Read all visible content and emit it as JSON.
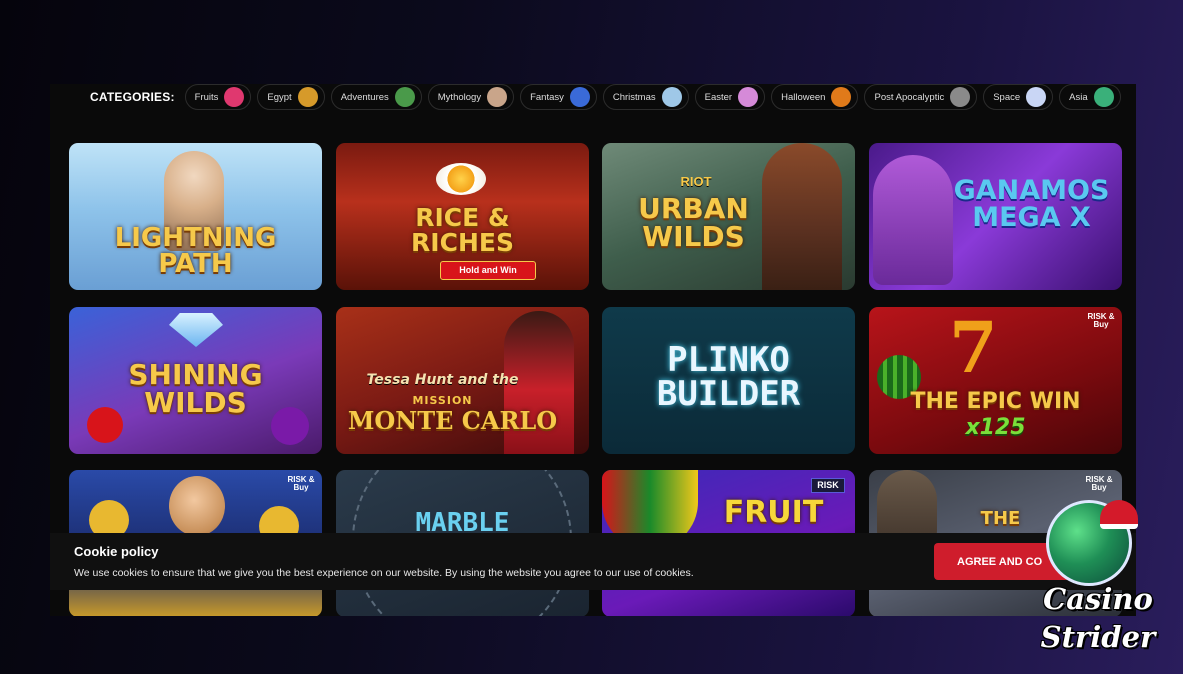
{
  "categories": {
    "label": "CATEGORIES:",
    "items": [
      {
        "label": "Fruits",
        "icon": "dragon-fruit-icon",
        "color": "#e0386f"
      },
      {
        "label": "Egypt",
        "icon": "pharaoh-icon",
        "color": "#d69a2a"
      },
      {
        "label": "Adventures",
        "icon": "explorer-icon",
        "color": "#4a9a4a"
      },
      {
        "label": "Mythology",
        "icon": "zeus-icon",
        "color": "#c9a58a"
      },
      {
        "label": "Fantasy",
        "icon": "blue-dragon-icon",
        "color": "#3a6ad8"
      },
      {
        "label": "Christmas",
        "icon": "snow-globe-icon",
        "color": "#9fc8e8"
      },
      {
        "label": "Easter",
        "icon": "easter-egg-icon",
        "color": "#d58ad8"
      },
      {
        "label": "Halloween",
        "icon": "pumpkin-icon",
        "color": "#e07a1a"
      },
      {
        "label": "Post Apocalyptic",
        "icon": "gas-mask-icon",
        "color": "#8a8a8a"
      },
      {
        "label": "Space",
        "icon": "ufo-icon",
        "color": "#c9d6f5"
      },
      {
        "label": "Asia",
        "icon": "asian-dragon-icon",
        "color": "#3ab07a"
      }
    ]
  },
  "games": [
    {
      "title": "LIGHTNING PATH",
      "bg": "linear-gradient(180deg,#bfe3f7 0%,#8ec3ea 45%,#6a9fd4 100%)"
    },
    {
      "title": "RICE & RICHES",
      "subtitle": "Hold and Win",
      "bg": "linear-gradient(180deg,#7a1a10 0%,#b8301c 40%,#5a1208 100%)"
    },
    {
      "title": "URBAN WILDS",
      "publisher": "RIOT",
      "bg": "linear-gradient(160deg,#6f8a78 0%,#3f5e4c 50%,#2a3a30 100%)"
    },
    {
      "title": "GANAMOS MEGA X",
      "bg": "linear-gradient(135deg,#4a1a8a 0%,#8a3ad8 50%,#3a1070 100%)"
    },
    {
      "title": "SHINING WILDS",
      "bg": "linear-gradient(160deg,#3a62d8 0%,#7a3ab8 55%,#4a1a6a 100%)"
    },
    {
      "title": "MONTE CARLO",
      "pretitle": "Tessa Hunt and the",
      "mission": "MISSION",
      "bg": "linear-gradient(160deg,#a83018 0%,#7a1a14 50%,#3a0a0a 100%)"
    },
    {
      "title": "PLINKO BUILDER",
      "bg": "linear-gradient(180deg,#0f3a4a 0%,#0b2a38 100%)"
    },
    {
      "title": "THE EPIC WIN",
      "multiplier": "x125",
      "badge": "RISK & Buy",
      "bg": "linear-gradient(160deg,#b8141a 0%,#7a0a0e 60%,#4a0508 100%)"
    },
    {
      "title": "",
      "badge": "RISK & Buy",
      "bg": "linear-gradient(180deg,#2a4aa8 0%,#1a2a6a 60%,#c89a2a 100%)"
    },
    {
      "title": "MARBLE",
      "bg": "linear-gradient(160deg,#2a3a4a 0%,#1a2430 100%)"
    },
    {
      "title": "FRUIT",
      "badge": "RISK",
      "bg": "linear-gradient(160deg,#3a2ab8 0%,#6a1ab8 60%,#2a0a6a 100%)"
    },
    {
      "title": "THE",
      "badge": "RISK & Buy",
      "bg": "linear-gradient(160deg,#3a3f48 0%,#5a6070 50%,#2a2e36 100%)"
    }
  ],
  "cookie": {
    "title": "Cookie policy",
    "text": "We use cookies to ensure that we give you the best experience on our website. By using the website you agree to our use of cookies.",
    "button": "AGREE AND CO"
  },
  "watermark": {
    "line1": "Casino",
    "line2": "Strider"
  }
}
